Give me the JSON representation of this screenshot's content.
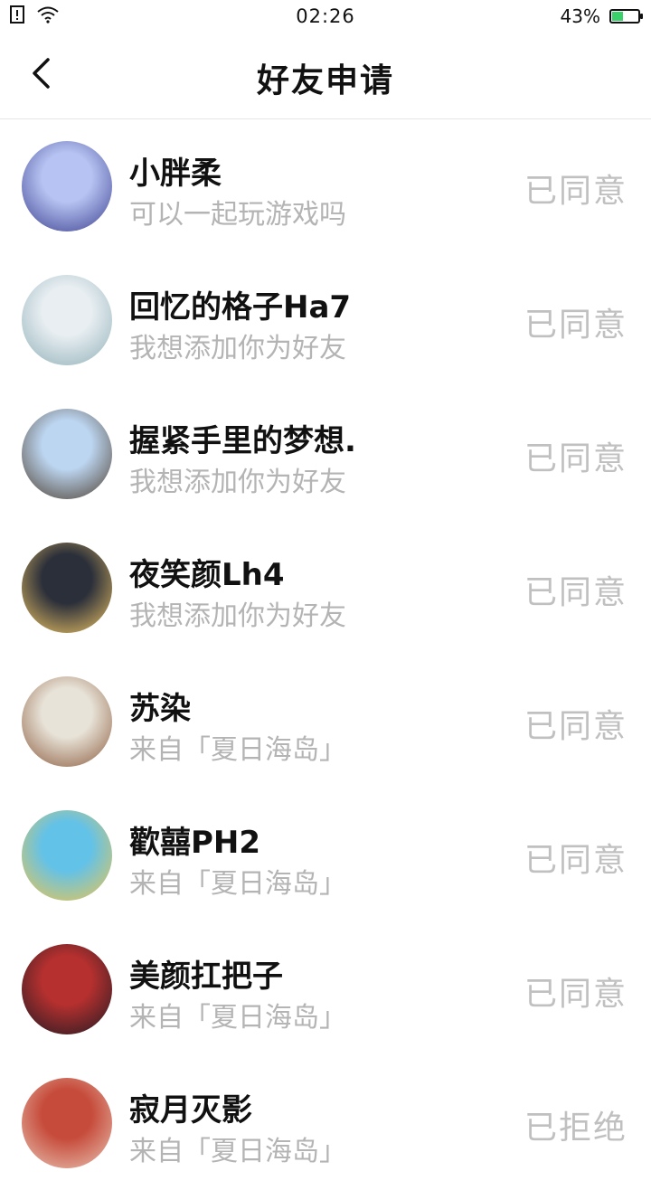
{
  "status_bar": {
    "time": "02:26",
    "battery_percent": "43%",
    "battery_level": 0.43
  },
  "header": {
    "title": "好友申请",
    "back_icon": "chevron-left-icon"
  },
  "requests": [
    {
      "name": "小胖柔",
      "message": "可以一起玩游戏吗",
      "status": "已同意",
      "avatar_colors": [
        "#3a3f8f",
        "#b7c3f2"
      ]
    },
    {
      "name": "回忆的格子Ha7",
      "message": "我想添加你为好友",
      "status": "已同意",
      "avatar_colors": [
        "#8fb0b7",
        "#e8eef2"
      ]
    },
    {
      "name": "握紧手里的梦想.",
      "message": "我想添加你为好友",
      "status": "已同意",
      "avatar_colors": [
        "#4a3b2c",
        "#bcd5f0"
      ]
    },
    {
      "name": "夜笑颜Lh4",
      "message": "我想添加你为好友",
      "status": "已同意",
      "avatar_colors": [
        "#f1c765",
        "#2b2f3a"
      ]
    },
    {
      "name": "苏染",
      "message": "来自「夏日海岛」",
      "status": "已同意",
      "avatar_colors": [
        "#8a5a3c",
        "#e8e3d8"
      ]
    },
    {
      "name": "歡囍PH2",
      "message": "来自「夏日海岛」",
      "status": "已同意",
      "avatar_colors": [
        "#f0c64c",
        "#63c2e8"
      ]
    },
    {
      "name": "美颜扛把子",
      "message": "来自「夏日海岛」",
      "status": "已同意",
      "avatar_colors": [
        "#1f1a22",
        "#b5302f"
      ]
    },
    {
      "name": "寂月灭影",
      "message": "来自「夏日海岛」",
      "status": "已拒绝",
      "avatar_colors": [
        "#e9c6b5",
        "#c64b3b"
      ]
    }
  ]
}
